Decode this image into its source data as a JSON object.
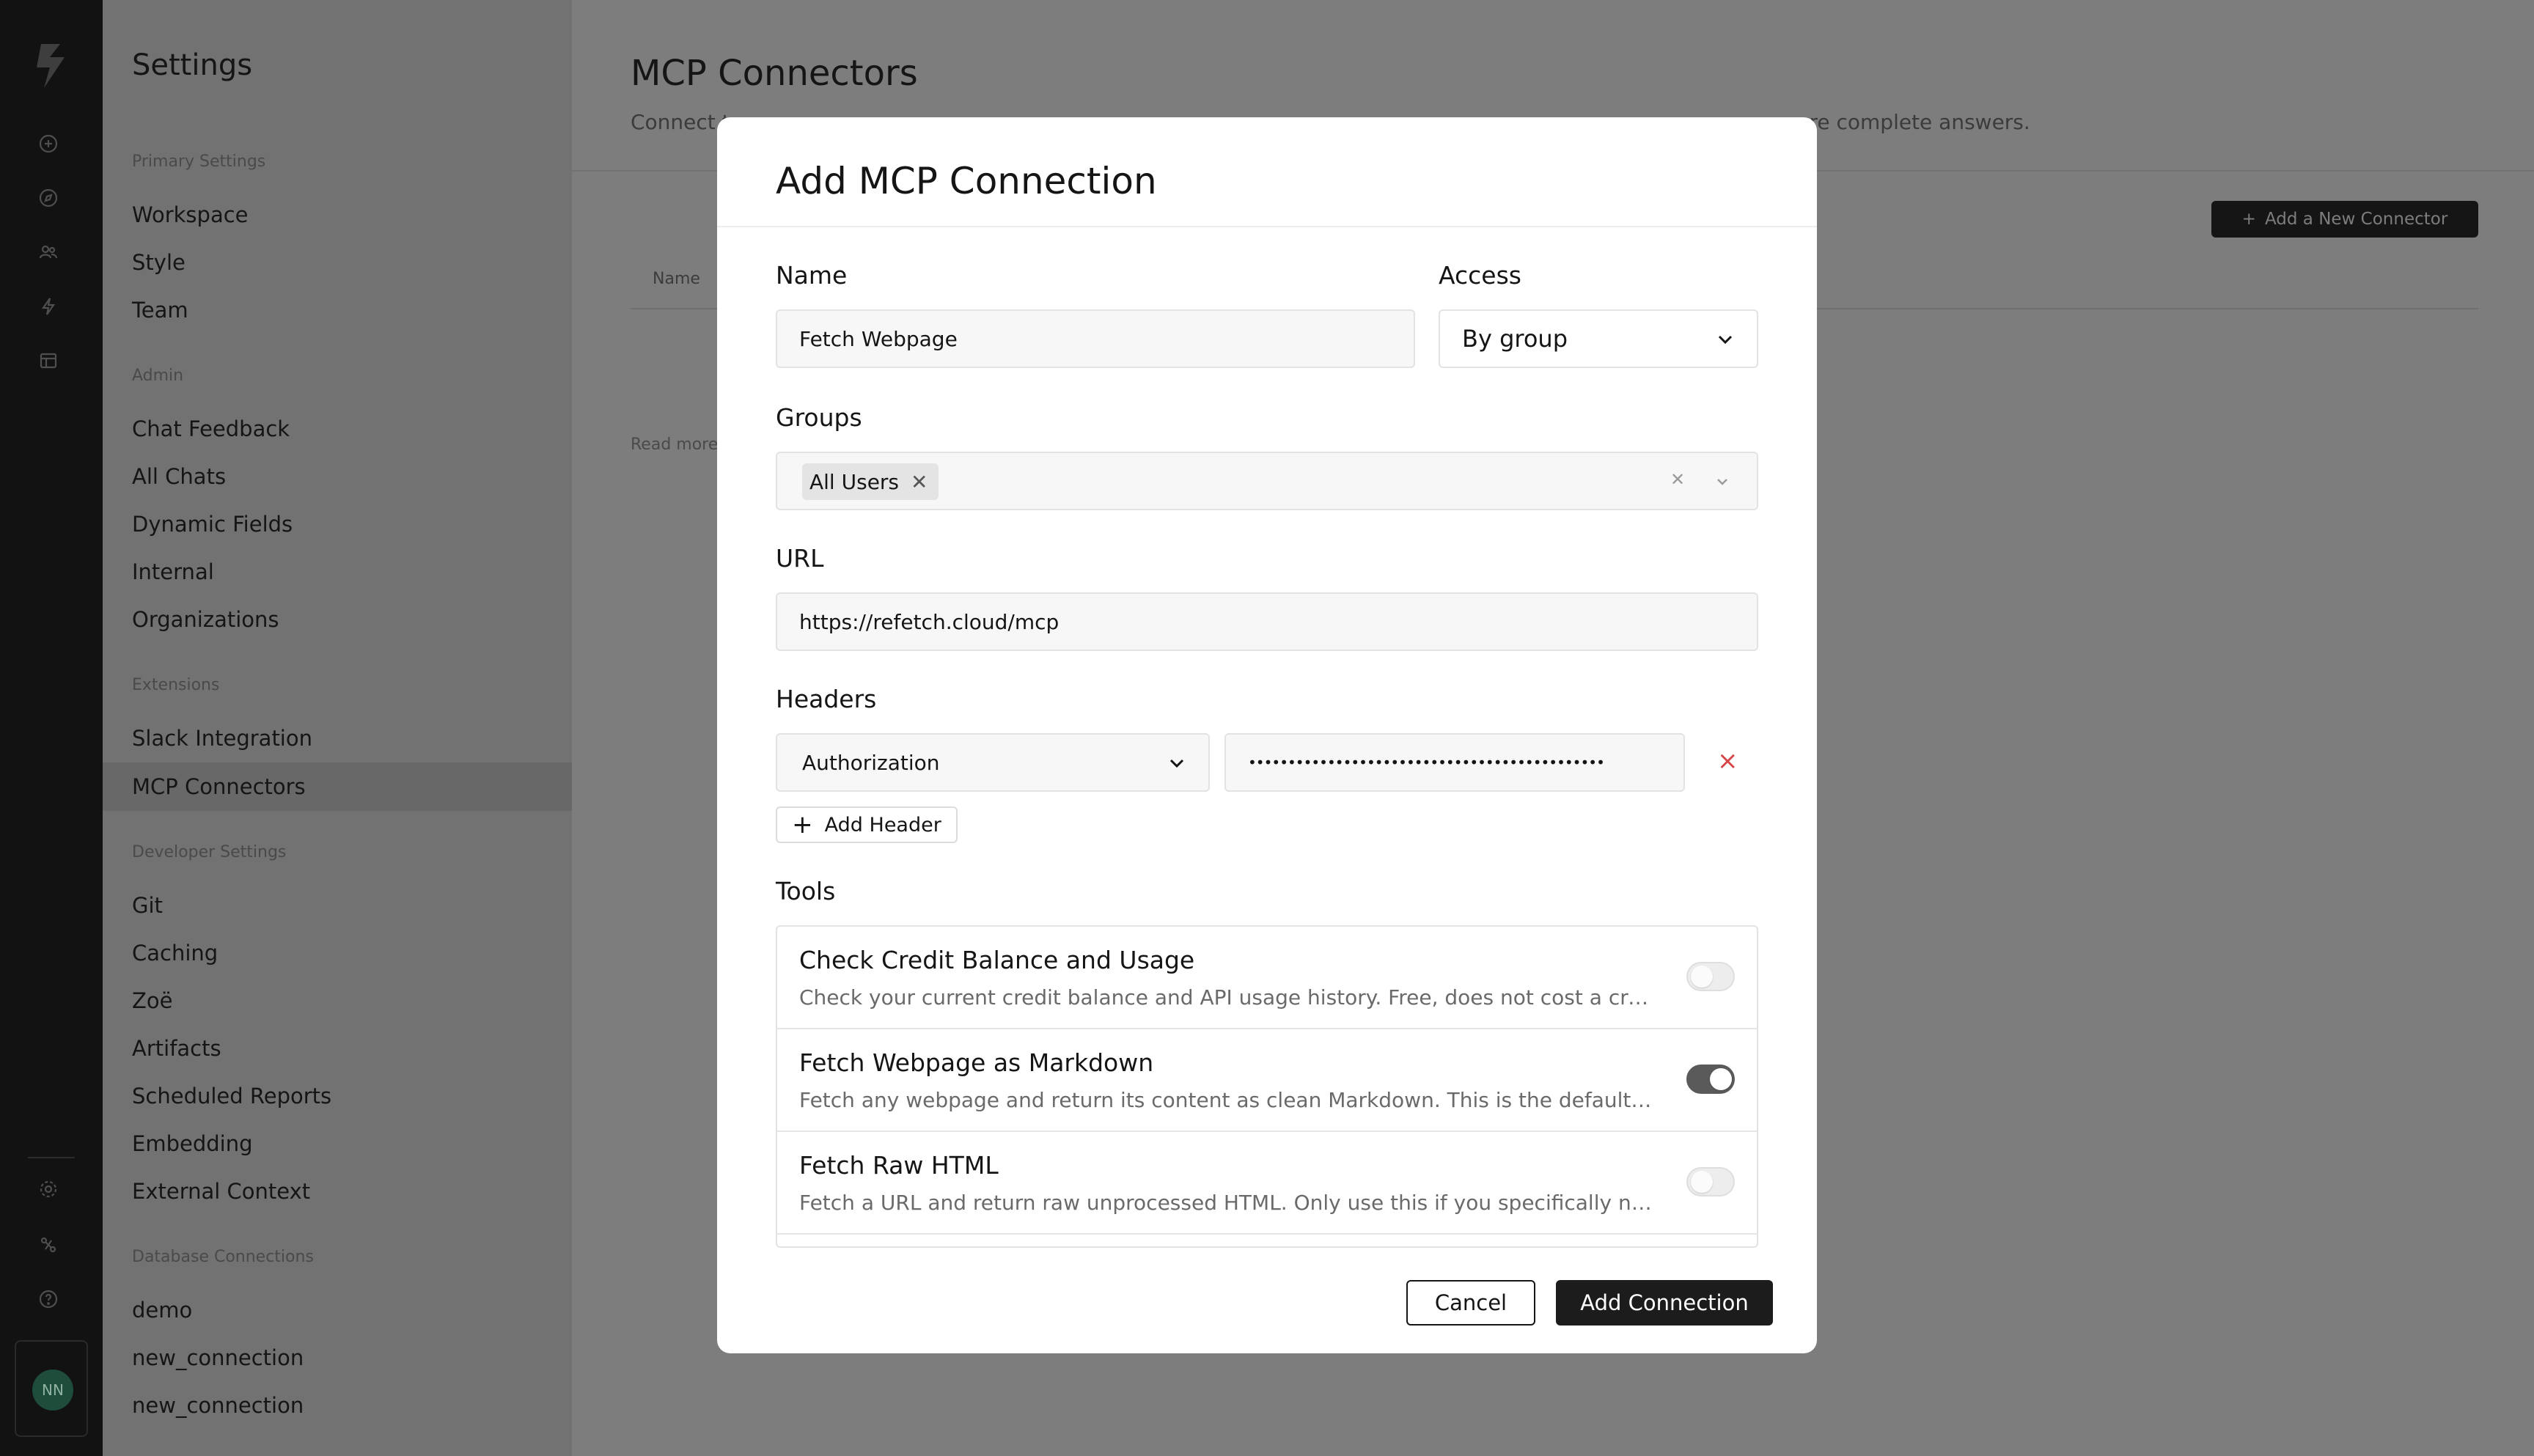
{
  "rail": {
    "icons": [
      "logo-icon",
      "plus-circle-icon",
      "compass-icon",
      "users-icon",
      "bolt-icon",
      "table-icon",
      "gear-icon",
      "connector-icon",
      "help-icon"
    ],
    "avatar_initials": "NN"
  },
  "sidebar": {
    "title": "Settings",
    "sections": [
      {
        "label": "Primary Settings",
        "items": [
          "Workspace",
          "Style",
          "Team"
        ]
      },
      {
        "label": "Admin",
        "items": [
          "Chat Feedback",
          "All Chats",
          "Dynamic Fields",
          "Internal",
          "Organizations"
        ]
      },
      {
        "label": "Extensions",
        "items": [
          "Slack Integration",
          "MCP Connectors"
        ]
      },
      {
        "label": "Developer Settings",
        "items": [
          "Git",
          "Caching",
          "Zoë",
          "Artifacts",
          "Scheduled Reports",
          "Embedding",
          "External Context"
        ]
      },
      {
        "label": "Database Connections",
        "items": [
          "demo",
          "new_connection",
          "new_connection"
        ]
      }
    ],
    "active_item": "MCP Connectors"
  },
  "main": {
    "title": "MCP Connectors",
    "subtitle_left": "Connect t",
    "subtitle_right": "re complete answers.",
    "add_connector_label": "Add a New Connector",
    "column_name": "Name",
    "read_more": "Read more"
  },
  "modal": {
    "title": "Add MCP Connection",
    "name_label": "Name",
    "name_value": "Fetch Webpage",
    "access_label": "Access",
    "access_value": "By group",
    "groups_label": "Groups",
    "groups_tags": [
      "All Users"
    ],
    "url_label": "URL",
    "url_value": "https://refetch.cloud/mcp",
    "headers_label": "Headers",
    "header_key": "Authorization",
    "header_value": "•••••••••••••••••••••••••••••••••••••••••••••",
    "add_header_label": "Add Header",
    "tools_label": "Tools",
    "tools": [
      {
        "name": "Check Credit Balance and Usage",
        "description": "Check your current credit balance and API usage history. Free, does not cost a credit....",
        "enabled": false
      },
      {
        "name": "Fetch Webpage as Markdown",
        "description": "Fetch any webpage and return its content as clean Markdown. This is the default tool f...",
        "enabled": true
      },
      {
        "name": "Fetch Raw HTML",
        "description": "Fetch a URL and return raw unprocessed HTML. Only use this if you specifically need t...",
        "enabled": false
      }
    ],
    "cancel_label": "Cancel",
    "submit_label": "Add Connection"
  },
  "colors": {
    "overlay": "#7d7d7d",
    "rail": "#121212",
    "primary_button": "#1c1c1c",
    "remove_icon": "#d64545"
  }
}
